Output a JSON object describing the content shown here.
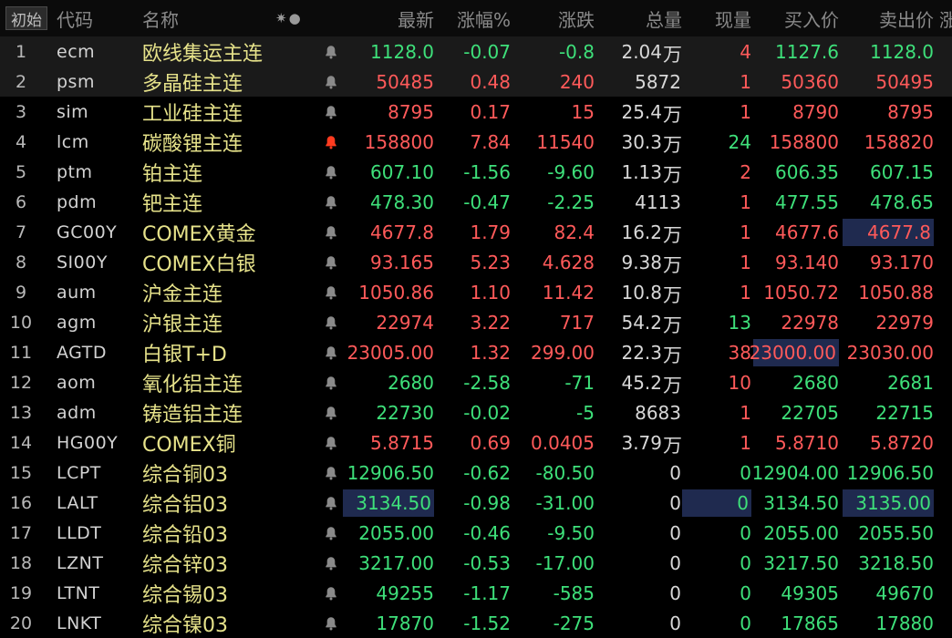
{
  "header": {
    "first_button": "初始",
    "code": "代码",
    "name": "名称",
    "icons": "✷●",
    "last": "最新",
    "pct": "涨幅%",
    "chg": "涨跌",
    "vol": "总量",
    "cur": "现量",
    "bid": "买入价",
    "ask": "卖出价",
    "edge": "涨"
  },
  "colors": {
    "up": "#ff5a5a",
    "down": "#3ee07a",
    "name": "#e6e28a",
    "highlight": "#1f2a4f",
    "alert_bell": "#ff3b1f",
    "bell": "#8a8a8a"
  },
  "rows": [
    {
      "idx": "1",
      "code": "ecm",
      "name": "欧线集运主连",
      "last": "1128.0",
      "pct": "-0.07",
      "chg": "-0.8",
      "vol": "2.04",
      "vol_unit": "万",
      "cur": "4",
      "bid": "1127.6",
      "ask": "1128.0",
      "dir": "down",
      "bell": "normal"
    },
    {
      "idx": "2",
      "code": "psm",
      "name": "多晶硅主连",
      "last": "50485",
      "pct": "0.48",
      "chg": "240",
      "vol": "5872",
      "vol_unit": "",
      "cur": "1",
      "bid": "50360",
      "ask": "50495",
      "dir": "up",
      "bell": "normal"
    },
    {
      "idx": "3",
      "code": "sim",
      "name": "工业硅主连",
      "last": "8795",
      "pct": "0.17",
      "chg": "15",
      "vol": "25.4",
      "vol_unit": "万",
      "cur": "1",
      "bid": "8790",
      "ask": "8795",
      "dir": "up",
      "bell": "normal"
    },
    {
      "idx": "4",
      "code": "lcm",
      "name": "碳酸锂主连",
      "last": "158800",
      "pct": "7.84",
      "chg": "11540",
      "vol": "30.3",
      "vol_unit": "万",
      "cur": "24",
      "bid": "158800",
      "ask": "158820",
      "dir": "up",
      "bell": "alert"
    },
    {
      "idx": "5",
      "code": "ptm",
      "name": "铂主连",
      "last": "607.10",
      "pct": "-1.56",
      "chg": "-9.60",
      "vol": "1.13",
      "vol_unit": "万",
      "cur": "2",
      "bid": "606.35",
      "ask": "607.15",
      "dir": "down",
      "bell": "normal"
    },
    {
      "idx": "6",
      "code": "pdm",
      "name": "钯主连",
      "last": "478.30",
      "pct": "-0.47",
      "chg": "-2.25",
      "vol": "4113",
      "vol_unit": "",
      "cur": "1",
      "bid": "477.55",
      "ask": "478.65",
      "dir": "down",
      "bell": "normal"
    },
    {
      "idx": "7",
      "code": "GC00Y",
      "name": "COMEX黄金",
      "last": "4677.8",
      "pct": "1.79",
      "chg": "82.4",
      "vol": "16.2",
      "vol_unit": "万",
      "cur": "1",
      "bid": "4677.6",
      "ask": "4677.8",
      "dir": "up",
      "bell": "normal"
    },
    {
      "idx": "8",
      "code": "SI00Y",
      "name": "COMEX白银",
      "last": "93.165",
      "pct": "5.23",
      "chg": "4.628",
      "vol": "9.38",
      "vol_unit": "万",
      "cur": "1",
      "bid": "93.140",
      "ask": "93.170",
      "dir": "up",
      "bell": "normal"
    },
    {
      "idx": "9",
      "code": "aum",
      "name": "沪金主连",
      "last": "1050.86",
      "pct": "1.10",
      "chg": "11.42",
      "vol": "10.8",
      "vol_unit": "万",
      "cur": "1",
      "bid": "1050.72",
      "ask": "1050.88",
      "dir": "up",
      "bell": "normal"
    },
    {
      "idx": "10",
      "code": "agm",
      "name": "沪银主连",
      "last": "22974",
      "pct": "3.22",
      "chg": "717",
      "vol": "54.2",
      "vol_unit": "万",
      "cur": "13",
      "bid": "22978",
      "ask": "22979",
      "dir": "up",
      "bell": "normal"
    },
    {
      "idx": "11",
      "code": "AGTD",
      "name": "白银T+D",
      "last": "23005.00",
      "pct": "1.32",
      "chg": "299.00",
      "vol": "22.3",
      "vol_unit": "万",
      "cur": "38",
      "bid": "23000.00",
      "ask": "23030.00",
      "dir": "up",
      "bell": "normal"
    },
    {
      "idx": "12",
      "code": "aom",
      "name": "氧化铝主连",
      "last": "2680",
      "pct": "-2.58",
      "chg": "-71",
      "vol": "45.2",
      "vol_unit": "万",
      "cur": "10",
      "bid": "2680",
      "ask": "2681",
      "dir": "down",
      "bell": "normal"
    },
    {
      "idx": "13",
      "code": "adm",
      "name": "铸造铝主连",
      "last": "22730",
      "pct": "-0.02",
      "chg": "-5",
      "vol": "8683",
      "vol_unit": "",
      "cur": "1",
      "bid": "22705",
      "ask": "22715",
      "dir": "down",
      "bell": "normal"
    },
    {
      "idx": "14",
      "code": "HG00Y",
      "name": "COMEX铜",
      "last": "5.8715",
      "pct": "0.69",
      "chg": "0.0405",
      "vol": "3.79",
      "vol_unit": "万",
      "cur": "1",
      "bid": "5.8710",
      "ask": "5.8720",
      "dir": "up",
      "bell": "normal"
    },
    {
      "idx": "15",
      "code": "LCPT",
      "name": "综合铜03",
      "last": "12906.50",
      "pct": "-0.62",
      "chg": "-80.50",
      "vol": "0",
      "vol_unit": "",
      "cur": "0",
      "bid": "12904.00",
      "ask": "12906.50",
      "dir": "down",
      "bell": "normal"
    },
    {
      "idx": "16",
      "code": "LALT",
      "name": "综合铝03",
      "last": "3134.50",
      "pct": "-0.98",
      "chg": "-31.00",
      "vol": "0",
      "vol_unit": "",
      "cur": "0",
      "bid": "3134.50",
      "ask": "3135.00",
      "dir": "down",
      "bell": "normal"
    },
    {
      "idx": "17",
      "code": "LLDT",
      "name": "综合铅03",
      "last": "2055.00",
      "pct": "-0.46",
      "chg": "-9.50",
      "vol": "0",
      "vol_unit": "",
      "cur": "0",
      "bid": "2055.00",
      "ask": "2055.50",
      "dir": "down",
      "bell": "normal"
    },
    {
      "idx": "18",
      "code": "LZNT",
      "name": "综合锌03",
      "last": "3217.00",
      "pct": "-0.53",
      "chg": "-17.00",
      "vol": "0",
      "vol_unit": "",
      "cur": "0",
      "bid": "3217.50",
      "ask": "3218.50",
      "dir": "down",
      "bell": "normal"
    },
    {
      "idx": "19",
      "code": "LTNT",
      "name": "综合锡03",
      "last": "49255",
      "pct": "-1.17",
      "chg": "-585",
      "vol": "0",
      "vol_unit": "",
      "cur": "0",
      "bid": "49305",
      "ask": "49670",
      "dir": "down",
      "bell": "normal"
    },
    {
      "idx": "20",
      "code": "LNKT",
      "name": "综合镍03",
      "last": "17870",
      "pct": "-1.52",
      "chg": "-275",
      "vol": "0",
      "vol_unit": "",
      "cur": "0",
      "bid": "17865",
      "ask": "17880",
      "dir": "down",
      "bell": "normal"
    }
  ]
}
